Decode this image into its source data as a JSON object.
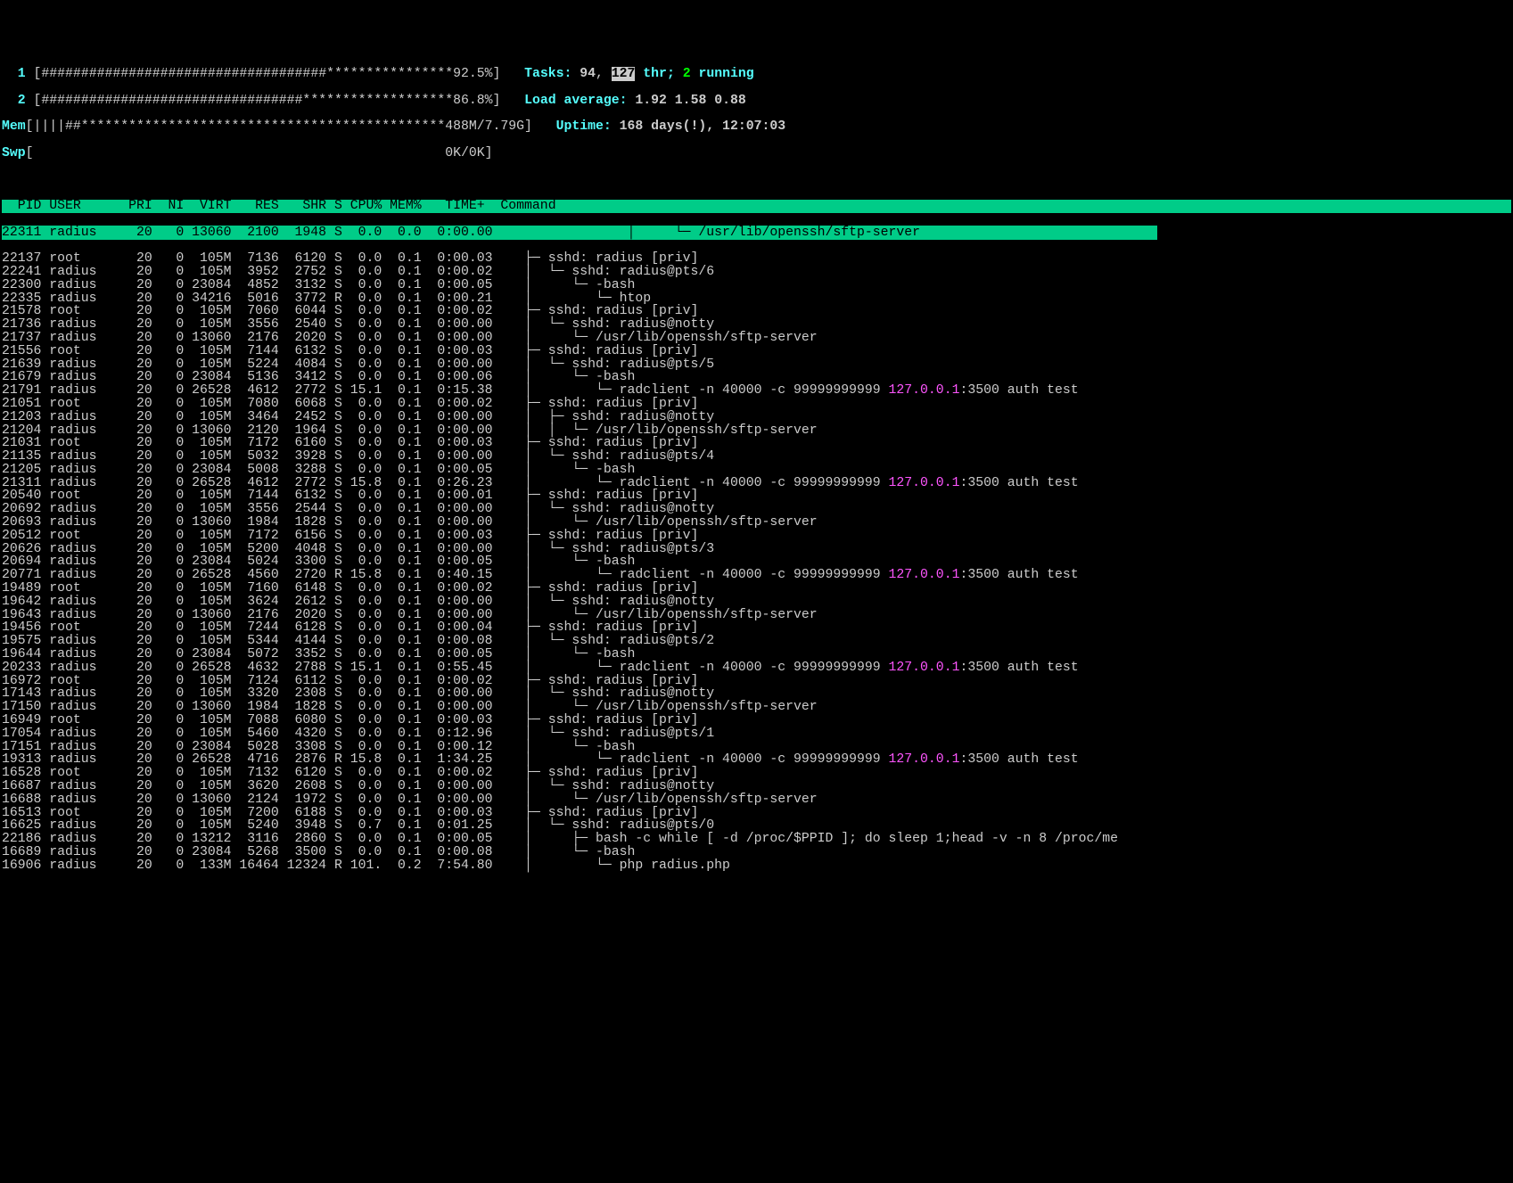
{
  "meters": {
    "cpu1_label": "  1 ",
    "cpu1_bar": "[####################################****************92.5%]",
    "cpu2_label": "  2 ",
    "cpu2_bar": "[#################################*******************86.8%]",
    "mem_label": "Mem",
    "mem_bar": "[||||##**********************************************488M/7.79G]",
    "swp_label": "Swp",
    "swp_bar": "[                                                    0K/0K]"
  },
  "status": {
    "tasks_pre": "Tasks: ",
    "tasks_n": "94",
    "tasks_mid": ", ",
    "tasks_thr": "127",
    "tasks_post": " thr; ",
    "tasks_run": "2",
    "tasks_end": " running",
    "load_label": "Load average: ",
    "load_vals": "1.92 1.58 0.88",
    "uptime_label": "Uptime: ",
    "uptime_val": "168 days(!), 12:07:03"
  },
  "columns": "  PID USER      PRI  NI  VIRT   RES   SHR S CPU% MEM%   TIME+  Command                                                                                     ",
  "sel_cols": "22311 radius     20   0 13060  2100  1948 S  0.0  0.0  0:00.00 ",
  "sel_cmd": "                │     └─ /usr/lib/openssh/sftp-server                              ",
  "rows": [
    {
      "c": "22137 root       20   0  105M  7136  6120 S  0.0  0.1  0:00.03 ",
      "t": "   ├─ ",
      "cmd": "sshd: radius [priv]"
    },
    {
      "c": "22241 radius     20   0  105M  3952  2752 S  0.0  0.1  0:00.02 ",
      "t": "   │  └─ ",
      "cmd": "sshd: radius@pts/6"
    },
    {
      "c": "22300 radius     20   0 23084  4852  3132 S  0.0  0.1  0:00.05 ",
      "t": "   │     └─ ",
      "cmd": "-bash"
    },
    {
      "c": "22335 radius     20   0 34216  5016  3772 R  0.0  0.1  0:00.21 ",
      "t": "   │        └─ ",
      "cmd": "htop"
    },
    {
      "c": "21578 root       20   0  105M  7060  6044 S  0.0  0.1  0:00.02 ",
      "t": "   ├─ ",
      "cmd": "sshd: radius [priv]"
    },
    {
      "c": "21736 radius     20   0  105M  3556  2540 S  0.0  0.1  0:00.00 ",
      "t": "   │  └─ ",
      "cmd": "sshd: radius@notty"
    },
    {
      "c": "21737 radius     20   0 13060  2176  2020 S  0.0  0.1  0:00.00 ",
      "t": "   │     └─ ",
      "cmd": "/usr/lib/openssh/sftp-server"
    },
    {
      "c": "21556 root       20   0  105M  7144  6132 S  0.0  0.1  0:00.03 ",
      "t": "   ├─ ",
      "cmd": "sshd: radius [priv]"
    },
    {
      "c": "21639 radius     20   0  105M  5224  4084 S  0.0  0.1  0:00.00 ",
      "t": "   │  └─ ",
      "cmd": "sshd: radius@pts/5"
    },
    {
      "c": "21679 radius     20   0 23084  5136  3412 S  0.0  0.1  0:00.06 ",
      "t": "   │     └─ ",
      "cmd": "-bash"
    },
    {
      "c": "21791 radius     20   0 26528  4612  2772 S 15.1  0.1  0:15.38 ",
      "t": "   │        └─ ",
      "cmd": "radclient -n 40000 -c 99999999999 ",
      "ip": "127.0.0.1",
      "post": ":3500 auth test"
    },
    {
      "c": "21051 root       20   0  105M  7080  6068 S  0.0  0.1  0:00.02 ",
      "t": "   ├─ ",
      "cmd": "sshd: radius [priv]"
    },
    {
      "c": "21203 radius     20   0  105M  3464  2452 S  0.0  0.1  0:00.00 ",
      "t": "   │  ├─ ",
      "cmd": "sshd: radius@notty"
    },
    {
      "c": "21204 radius     20   0 13060  2120  1964 S  0.0  0.1  0:00.00 ",
      "t": "   │  │  └─ ",
      "cmd": "/usr/lib/openssh/sftp-server"
    },
    {
      "c": "21031 root       20   0  105M  7172  6160 S  0.0  0.1  0:00.03 ",
      "t": "   ├─ ",
      "cmd": "sshd: radius [priv]"
    },
    {
      "c": "21135 radius     20   0  105M  5032  3928 S  0.0  0.1  0:00.00 ",
      "t": "   │  └─ ",
      "cmd": "sshd: radius@pts/4"
    },
    {
      "c": "21205 radius     20   0 23084  5008  3288 S  0.0  0.1  0:00.05 ",
      "t": "   │     └─ ",
      "cmd": "-bash"
    },
    {
      "c": "21311 radius     20   0 26528  4612  2772 S 15.8  0.1  0:26.23 ",
      "t": "   │        └─ ",
      "cmd": "radclient -n 40000 -c 99999999999 ",
      "ip": "127.0.0.1",
      "post": ":3500 auth test"
    },
    {
      "c": "20540 root       20   0  105M  7144  6132 S  0.0  0.1  0:00.01 ",
      "t": "   ├─ ",
      "cmd": "sshd: radius [priv]"
    },
    {
      "c": "20692 radius     20   0  105M  3556  2544 S  0.0  0.1  0:00.00 ",
      "t": "   │  └─ ",
      "cmd": "sshd: radius@notty"
    },
    {
      "c": "20693 radius     20   0 13060  1984  1828 S  0.0  0.1  0:00.00 ",
      "t": "   │     └─ ",
      "cmd": "/usr/lib/openssh/sftp-server"
    },
    {
      "c": "20512 root       20   0  105M  7172  6156 S  0.0  0.1  0:00.03 ",
      "t": "   ├─ ",
      "cmd": "sshd: radius [priv]"
    },
    {
      "c": "20626 radius     20   0  105M  5200  4048 S  0.0  0.1  0:00.00 ",
      "t": "   │  └─ ",
      "cmd": "sshd: radius@pts/3"
    },
    {
      "c": "20694 radius     20   0 23084  5024  3300 S  0.0  0.1  0:00.05 ",
      "t": "   │     └─ ",
      "cmd": "-bash"
    },
    {
      "c": "20771 radius     20   0 26528  4560  2720 R 15.8  0.1  0:40.15 ",
      "t": "   │        └─ ",
      "cmd": "radclient -n 40000 -c 99999999999 ",
      "ip": "127.0.0.1",
      "post": ":3500 auth test"
    },
    {
      "c": "19489 root       20   0  105M  7160  6148 S  0.0  0.1  0:00.02 ",
      "t": "   ├─ ",
      "cmd": "sshd: radius [priv]"
    },
    {
      "c": "19642 radius     20   0  105M  3624  2612 S  0.0  0.1  0:00.00 ",
      "t": "   │  └─ ",
      "cmd": "sshd: radius@notty"
    },
    {
      "c": "19643 radius     20   0 13060  2176  2020 S  0.0  0.1  0:00.00 ",
      "t": "   │     └─ ",
      "cmd": "/usr/lib/openssh/sftp-server"
    },
    {
      "c": "19456 root       20   0  105M  7244  6128 S  0.0  0.1  0:00.04 ",
      "t": "   ├─ ",
      "cmd": "sshd: radius [priv]"
    },
    {
      "c": "19575 radius     20   0  105M  5344  4144 S  0.0  0.1  0:00.08 ",
      "t": "   │  └─ ",
      "cmd": "sshd: radius@pts/2"
    },
    {
      "c": "19644 radius     20   0 23084  5072  3352 S  0.0  0.1  0:00.05 ",
      "t": "   │     └─ ",
      "cmd": "-bash"
    },
    {
      "c": "20233 radius     20   0 26528  4632  2788 S 15.1  0.1  0:55.45 ",
      "t": "   │        └─ ",
      "cmd": "radclient -n 40000 -c 99999999999 ",
      "ip": "127.0.0.1",
      "post": ":3500 auth test"
    },
    {
      "c": "16972 root       20   0  105M  7124  6112 S  0.0  0.1  0:00.02 ",
      "t": "   ├─ ",
      "cmd": "sshd: radius [priv]"
    },
    {
      "c": "17143 radius     20   0  105M  3320  2308 S  0.0  0.1  0:00.00 ",
      "t": "   │  └─ ",
      "cmd": "sshd: radius@notty"
    },
    {
      "c": "17150 radius     20   0 13060  1984  1828 S  0.0  0.1  0:00.00 ",
      "t": "   │     └─ ",
      "cmd": "/usr/lib/openssh/sftp-server"
    },
    {
      "c": "16949 root       20   0  105M  7088  6080 S  0.0  0.1  0:00.03 ",
      "t": "   ├─ ",
      "cmd": "sshd: radius [priv]"
    },
    {
      "c": "17054 radius     20   0  105M  5460  4320 S  0.0  0.1  0:12.96 ",
      "t": "   │  └─ ",
      "cmd": "sshd: radius@pts/1"
    },
    {
      "c": "17151 radius     20   0 23084  5028  3308 S  0.0  0.1  0:00.12 ",
      "t": "   │     └─ ",
      "cmd": "-bash"
    },
    {
      "c": "19313 radius     20   0 26528  4716  2876 R 15.8  0.1  1:34.25 ",
      "t": "   │        └─ ",
      "cmd": "radclient -n 40000 -c 99999999999 ",
      "ip": "127.0.0.1",
      "post": ":3500 auth test"
    },
    {
      "c": "16528 root       20   0  105M  7132  6120 S  0.0  0.1  0:00.02 ",
      "t": "   ├─ ",
      "cmd": "sshd: radius [priv]"
    },
    {
      "c": "16687 radius     20   0  105M  3620  2608 S  0.0  0.1  0:00.00 ",
      "t": "   │  └─ ",
      "cmd": "sshd: radius@notty"
    },
    {
      "c": "16688 radius     20   0 13060  2124  1972 S  0.0  0.1  0:00.00 ",
      "t": "   │     └─ ",
      "cmd": "/usr/lib/openssh/sftp-server"
    },
    {
      "c": "16513 root       20   0  105M  7200  6188 S  0.0  0.1  0:00.03 ",
      "t": "   ├─ ",
      "cmd": "sshd: radius [priv]"
    },
    {
      "c": "16625 radius     20   0  105M  5240  3948 S  0.7  0.1  0:01.25 ",
      "t": "   │  └─ ",
      "cmd": "sshd: radius@pts/0"
    },
    {
      "c": "22186 radius     20   0 13212  3116  2860 S  0.0  0.1  0:00.05 ",
      "t": "   │     ├─ ",
      "cmd": "bash -c while [ -d /proc/$PPID ]; do sleep 1;head -v -n 8 /proc/me"
    },
    {
      "c": "16689 radius     20   0 23084  5268  3500 S  0.0  0.1  0:00.08 ",
      "t": "   │     └─ ",
      "cmd": "-bash"
    },
    {
      "c": "16906 radius     20   0  133M 16464 12324 R 101.  0.2  7:54.80 ",
      "t": "   │        └─ ",
      "cmd": "php radius.php"
    }
  ]
}
